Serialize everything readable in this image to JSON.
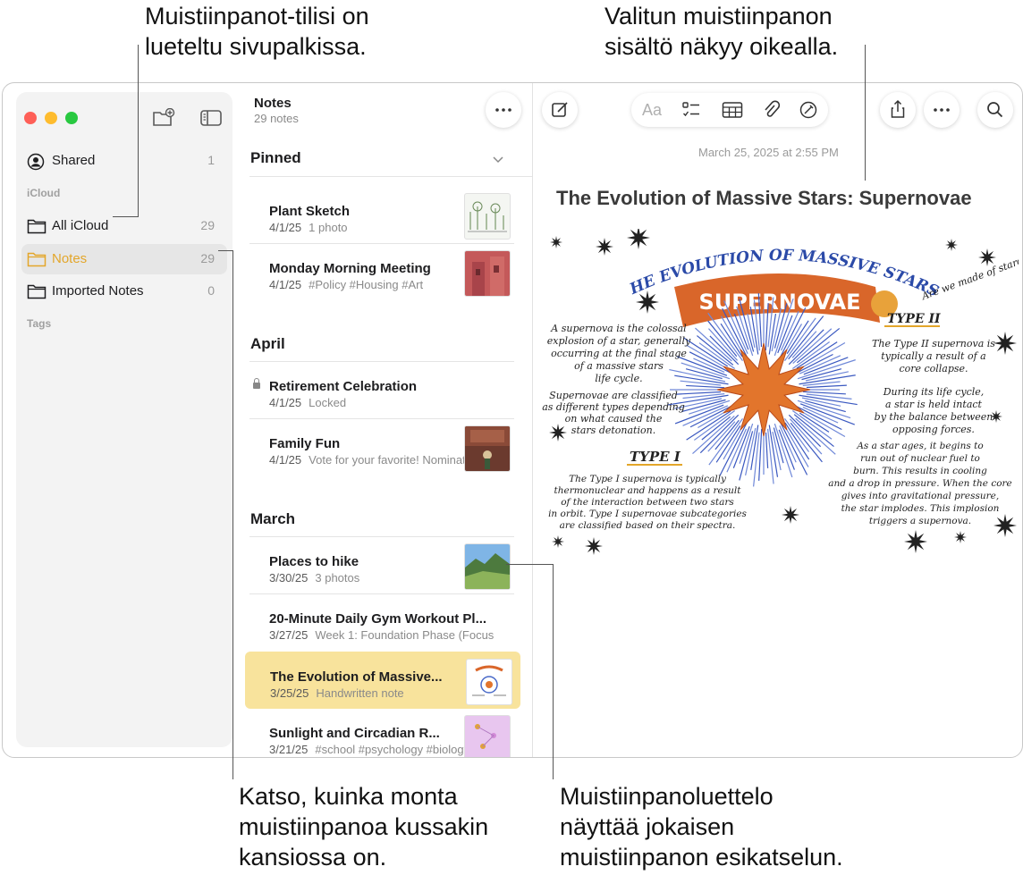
{
  "callouts": {
    "top_left": "Muistiinpanot-tilisi on\nlueteltu sivupalkissa.",
    "top_right": "Valitun muistiinpanon\nsisältö näkyy oikealla.",
    "bottom_left": "Katso, kuinka monta\nmuistiinpanoa kussakin\nkansiossa on.",
    "bottom_right": "Muistiinpanoluettelo\nnäyttää jokaisen\nmuistiinpanon esikatselun."
  },
  "sidebar": {
    "shared": {
      "label": "Shared",
      "count": "1"
    },
    "section_icloud": "iCloud",
    "items": [
      {
        "label": "All iCloud",
        "count": "29"
      },
      {
        "label": "Notes",
        "count": "29"
      },
      {
        "label": "Imported Notes",
        "count": "0"
      }
    ],
    "section_tags": "Tags"
  },
  "list": {
    "title": "Notes",
    "subtitle": "29 notes",
    "groups": {
      "pinned": "Pinned",
      "april": "April",
      "march": "March"
    },
    "notes": [
      {
        "title": "Plant Sketch",
        "date": "4/1/25",
        "preview": "1 photo"
      },
      {
        "title": "Monday Morning Meeting",
        "date": "4/1/25",
        "preview": "#Policy #Housing #Art"
      },
      {
        "title": "Retirement Celebration",
        "date": "4/1/25",
        "preview": "Locked"
      },
      {
        "title": "Family Fun",
        "date": "4/1/25",
        "preview": "Vote for your favorite! Nominate"
      },
      {
        "title": "Places to hike",
        "date": "3/30/25",
        "preview": "3 photos"
      },
      {
        "title": "20-Minute Daily Gym Workout Pl...",
        "date": "3/27/25",
        "preview": "Week 1: Foundation Phase (Focus"
      },
      {
        "title": "The Evolution of Massive...",
        "date": "3/25/25",
        "preview": "Handwritten note"
      },
      {
        "title": "Sunlight and Circadian R...",
        "date": "3/21/25",
        "preview": "#school #psychology #biology"
      }
    ]
  },
  "editor": {
    "timestamp": "March 25, 2025 at 2:55 PM",
    "title": "The Evolution of Massive Stars: Supernovae",
    "format_label": "Aa",
    "sketch": {
      "arc_title": "THE EVOLUTION OF MASSIVE STARS:",
      "banner": "SUPERNOVAE",
      "aside": "Are we made of stardust?",
      "type1_head": "TYPE I",
      "type2_head": "TYPE II",
      "left1": [
        "A supernova is the colossal",
        "explosion of a star, generally",
        "occurring at the final stage",
        "of a massive stars",
        "life cycle."
      ],
      "left2": [
        "Supernovae are classified",
        "as different types depending",
        "on what caused the",
        "stars detonation."
      ],
      "left3": [
        "The Type I supernova is typically",
        "thermonuclear and happens as a result",
        "of the interaction between two stars",
        "in orbit. Type I supernovae subcategories",
        "are classified based on their spectra."
      ],
      "right1": [
        "The Type II supernova is",
        "typically a result of a",
        "core collapse."
      ],
      "right2": [
        "During its life cycle,",
        "a star is held intact",
        "by the balance between",
        "opposing forces."
      ],
      "right3": [
        "As a star ages, it begins to",
        "run out of nuclear fuel to",
        "burn. This results in cooling",
        "and a drop in pressure. When the core",
        "gives into gravitational pressure,",
        "the star implodes. This implosion",
        "triggers a supernova."
      ]
    }
  },
  "colors": {
    "accent": "#e3a62a",
    "selected_note": "#f8e39c",
    "banner": "#d9662a"
  }
}
